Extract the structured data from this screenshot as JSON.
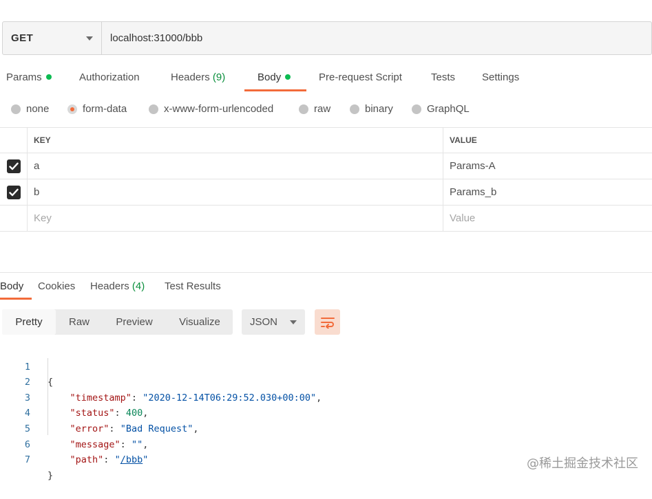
{
  "request": {
    "method": "GET",
    "url": "localhost:31000/bbb"
  },
  "request_tabs": {
    "params": "Params",
    "authorization": "Authorization",
    "headers": "Headers",
    "headers_count": "(9)",
    "body": "Body",
    "prerequest": "Pre-request Script",
    "tests": "Tests",
    "settings": "Settings"
  },
  "body_types": {
    "none": "none",
    "form_data": "form-data",
    "urlencoded": "x-www-form-urlencoded",
    "raw": "raw",
    "binary": "binary",
    "graphql": "GraphQL",
    "selected": "form-data"
  },
  "form_table": {
    "headers": {
      "key": "KEY",
      "value": "VALUE"
    },
    "rows": [
      {
        "checked": true,
        "key": "a",
        "value": "Params-A"
      },
      {
        "checked": true,
        "key": "b",
        "value": "Params_b"
      }
    ],
    "placeholder": {
      "key": "Key",
      "value": "Value"
    }
  },
  "response_tabs": {
    "body": "Body",
    "cookies": "Cookies",
    "headers": "Headers",
    "headers_count": "(4)",
    "test_results": "Test Results"
  },
  "response_toolbar": {
    "pretty": "Pretty",
    "raw": "Raw",
    "preview": "Preview",
    "visualize": "Visualize",
    "format": "JSON"
  },
  "response_body": {
    "line_numbers": [
      "1",
      "2",
      "3",
      "4",
      "5",
      "6",
      "7"
    ],
    "open_brace": "{",
    "close_brace": "}",
    "timestamp_key": "\"timestamp\"",
    "timestamp_value": "\"2020-12-14T06:29:52.030+00:00\"",
    "status_key": "\"status\"",
    "status_value": "400",
    "error_key": "\"error\"",
    "error_value": "\"Bad Request\"",
    "message_key": "\"message\"",
    "message_value": "\"\"",
    "path_key": "\"path\"",
    "path_value": "\"/bbb\""
  },
  "watermark": "@稀土掘金技术社区",
  "colors": {
    "accent": "#f26b3a",
    "active_dot": "#0cbb52",
    "count": "#0a8f3c"
  }
}
